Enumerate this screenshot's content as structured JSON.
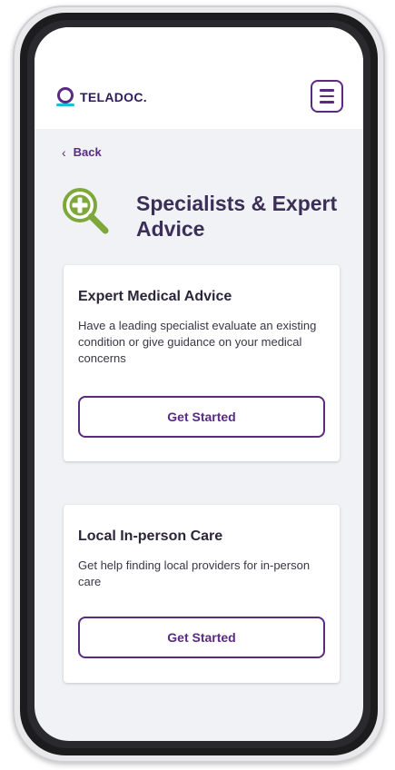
{
  "app": {
    "logo_text": "TELADOC."
  },
  "header": {
    "menu_icon": "hamburger-menu-icon"
  },
  "nav": {
    "back_label": "Back",
    "back_icon": "chevron-left-icon"
  },
  "page": {
    "title": "Specialists & Expert Advice",
    "title_icon": "magnifier-plus-icon"
  },
  "cards": [
    {
      "title": "Expert Medical Advice",
      "description": "Have a leading specialist evaluate an existing condition or give guidance on your medical concerns",
      "button_label": "Get Started"
    },
    {
      "title": "Local In-person Care",
      "description": "Get help finding local providers for in-person care",
      "button_label": "Get Started"
    }
  ],
  "colors": {
    "brand_purple": "#5a2a82",
    "brand_teal": "#19c0cf",
    "icon_green": "#7ea83a",
    "screen_bg": "#f1f2f6"
  }
}
